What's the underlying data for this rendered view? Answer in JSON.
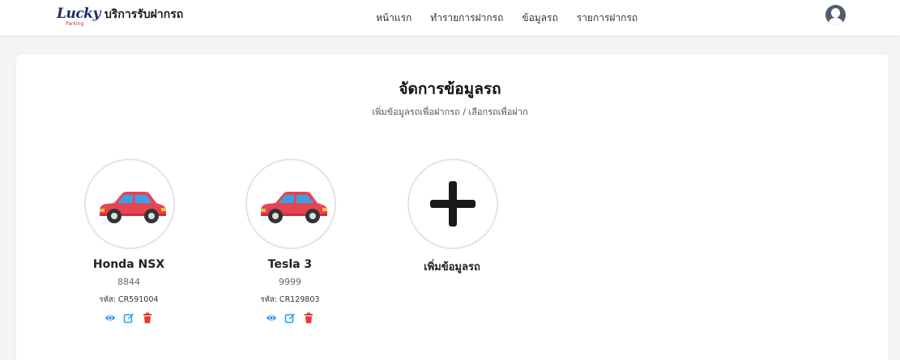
{
  "brand": {
    "logo_text": "Lucky",
    "logo_sub": "Parking",
    "name": "บริการรับฝากรถ"
  },
  "nav": [
    "หน้าแรก",
    "ทำรายการฝากรถ",
    "ข้อมูลรถ",
    "รายการฝากรถ"
  ],
  "page": {
    "title": "จัดการข้อมูลรถ",
    "subtitle": "เพิ่มข้อมูลรถเพื่อฝากรถ / เลือกรถเพื่อฝาก"
  },
  "cars": [
    {
      "name": "Honda NSX",
      "plate": "8844",
      "code": "รหัส: CR591004"
    },
    {
      "name": "Tesla 3",
      "plate": "9999",
      "code": "รหัส: CR129803"
    }
  ],
  "add": {
    "label": "เพิ่มข้อมูลรถ"
  },
  "icons": {
    "view": "eye-icon",
    "edit": "edit-icon",
    "delete": "trash-icon",
    "car": "car-icon",
    "add": "plus-icon",
    "avatar": "user-avatar-icon"
  },
  "colors": {
    "view": "#1e88e5",
    "edit": "#26a0e8",
    "delete": "#e53935",
    "car_body": "#e84352",
    "window": "#3aa0e8"
  }
}
